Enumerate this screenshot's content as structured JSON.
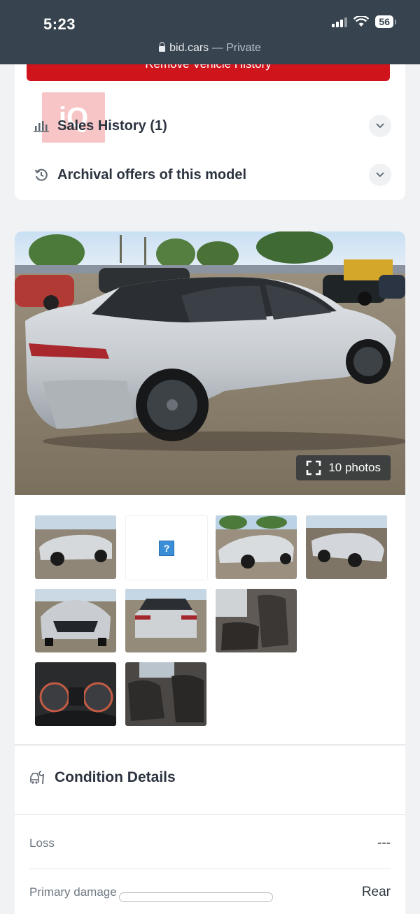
{
  "status": {
    "time": "5:23",
    "battery": "56"
  },
  "browser": {
    "domain": "bid.cars",
    "separator": " — ",
    "mode": "Private"
  },
  "top_card": {
    "remove_button_label": "Remove Vehicle History",
    "watermark": "iQ",
    "sales_history_label": "Sales History (1)",
    "archival_label": "Archival offers of this model"
  },
  "gallery": {
    "photos_count_label": "10 photos",
    "missing_thumb_glyph": "?"
  },
  "condition": {
    "title": "Condition Details",
    "rows": [
      {
        "label": "Loss",
        "value": "---"
      },
      {
        "label": "Primary damage",
        "value": "Rear"
      }
    ]
  },
  "colors": {
    "status_bar": "#37444f",
    "accent_red": "#d0141c",
    "page_bg": "#f1f2f4"
  }
}
